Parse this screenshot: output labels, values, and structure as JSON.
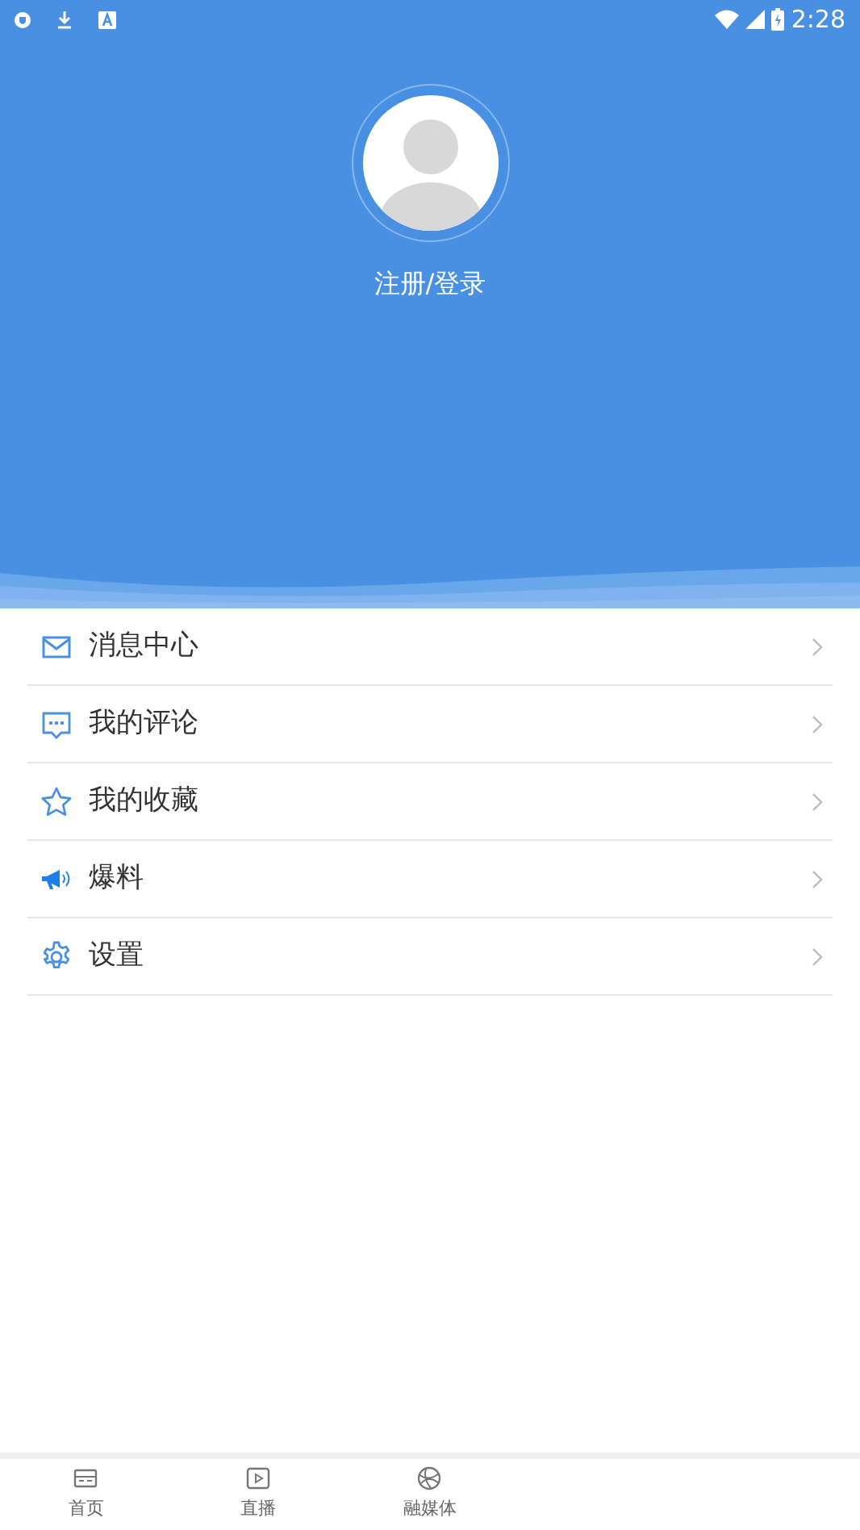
{
  "status_bar": {
    "time": "2:28"
  },
  "profile": {
    "login_label": "注册/登录"
  },
  "menu": [
    {
      "kind": "mail",
      "label": "消息中心"
    },
    {
      "kind": "comment",
      "label": "我的评论"
    },
    {
      "kind": "star",
      "label": "我的收藏"
    },
    {
      "kind": "megaphone",
      "label": "爆料"
    },
    {
      "kind": "gear",
      "label": "设置"
    }
  ],
  "tab_bar": [
    {
      "kind": "home",
      "label": "首页",
      "selected": false
    },
    {
      "kind": "live",
      "label": "直播",
      "selected": false
    },
    {
      "kind": "media",
      "label": "融媒体",
      "selected": false
    }
  ]
}
